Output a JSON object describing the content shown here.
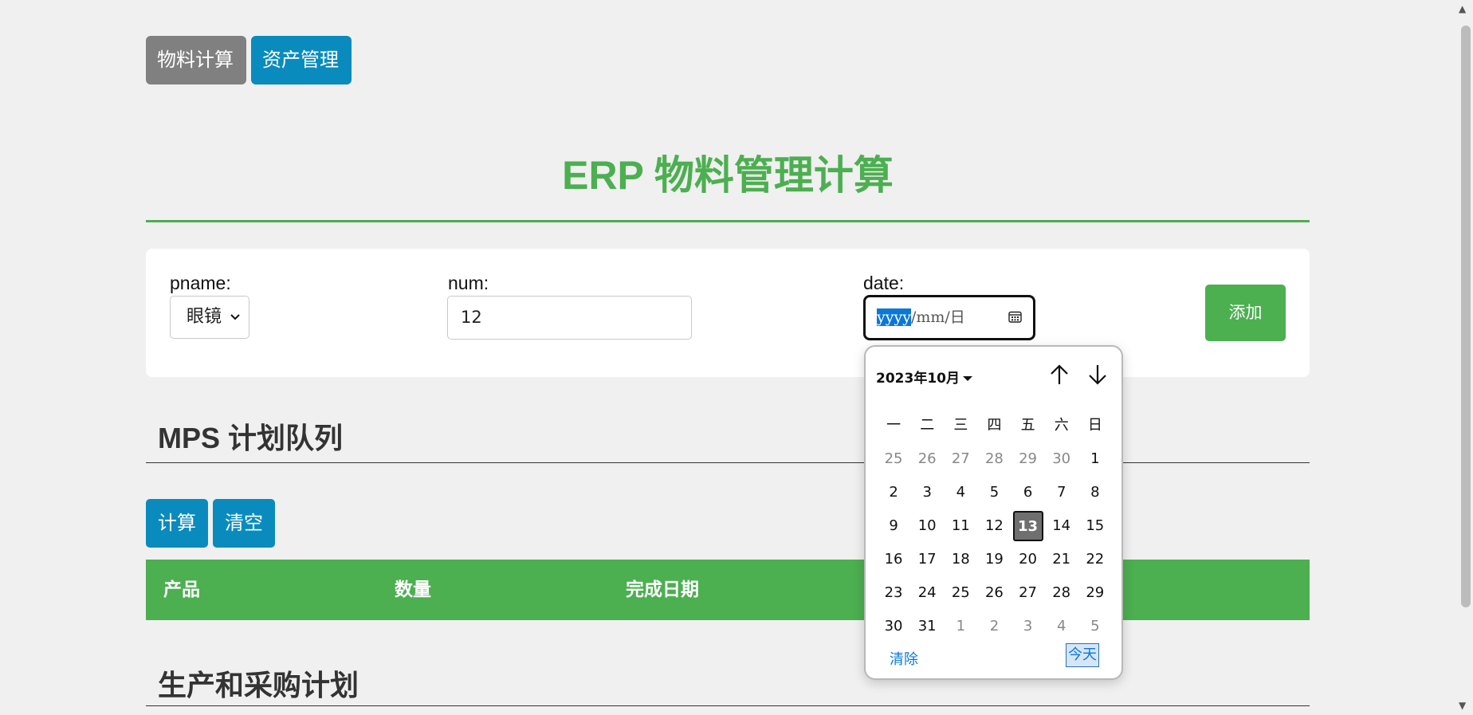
{
  "nav": {
    "tabs": [
      {
        "label": "物料计算"
      },
      {
        "label": "资产管理"
      }
    ]
  },
  "title": "ERP 物料管理计算",
  "form": {
    "pname_label": "pname:",
    "pname_value": "眼镜",
    "num_label": "num:",
    "num_value": "12",
    "date_label": "date:",
    "date_placeholder": {
      "year": "yyyy",
      "sep1": "/",
      "month": "mm",
      "sep2": "/",
      "day": "日"
    },
    "add_label": "添加"
  },
  "mps": {
    "heading": "MPS 计划队列",
    "calc_label": "计算",
    "clear_label": "清空",
    "columns": [
      "产品",
      "数量",
      "完成日期"
    ]
  },
  "plan": {
    "heading": "生产和采购计划"
  },
  "calendar": {
    "month_label": "2023年10月",
    "weekdays": [
      "一",
      "二",
      "三",
      "四",
      "五",
      "六",
      "日"
    ],
    "weeks": [
      [
        "25",
        "26",
        "27",
        "28",
        "29",
        "30",
        "1"
      ],
      [
        "2",
        "3",
        "4",
        "5",
        "6",
        "7",
        "8"
      ],
      [
        "9",
        "10",
        "11",
        "12",
        "13",
        "14",
        "15"
      ],
      [
        "16",
        "17",
        "18",
        "19",
        "20",
        "21",
        "22"
      ],
      [
        "23",
        "24",
        "25",
        "26",
        "27",
        "28",
        "29"
      ],
      [
        "30",
        "31",
        "1",
        "2",
        "3",
        "4",
        "5"
      ]
    ],
    "today": "13",
    "clear_label": "清除",
    "today_label": "今天"
  },
  "colors": {
    "accent": "#4caf50",
    "button_blue": "#0a8bbd",
    "tab_gray": "#808080"
  }
}
